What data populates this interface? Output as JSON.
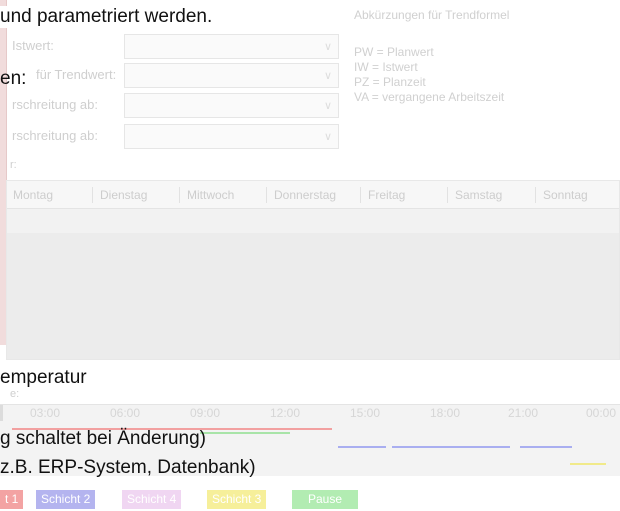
{
  "overlay": {
    "line1": "und parametriert werden.",
    "line2": "en:",
    "line3": "emperatur",
    "line4": "g  schaltet bei Änderung)",
    "line5": "z.B. ERP-System, Datenbank)"
  },
  "form": {
    "label_istwert": "Istwert:",
    "label_trendwert": "für Trendwert:",
    "label_ueber1": "rschreitung ab:",
    "label_ueber2": "rschreitung ab:",
    "label_small": "r:",
    "chevron": "∨"
  },
  "abbreviations": {
    "title": "Abkürzungen für Trendformel",
    "items": [
      "PW  =  Planwert",
      "IW  =  Istwert",
      "PZ  =  Planzeit",
      "VA   =  vergangene Arbeitszeit"
    ]
  },
  "week": {
    "days": [
      "Montag",
      "Dienstag",
      "Mittwoch",
      "Donnerstag",
      "Freitag",
      "Samstag",
      "Sonntag"
    ]
  },
  "timeline": {
    "caption": "e:",
    "ticks": [
      "03:00",
      "06:00",
      "09:00",
      "12:00",
      "15:00",
      "18:00",
      "21:00",
      "00:00"
    ]
  },
  "legend": {
    "items": [
      {
        "label": "t 1",
        "color": "#f3a3a3"
      },
      {
        "label": "Schicht 2",
        "color": "#b4b4ef"
      },
      {
        "label": "Schicht 4",
        "color": "#f0d6f2"
      },
      {
        "label": "Schicht 3",
        "color": "#f6ef9a"
      },
      {
        "label": "Pause",
        "color": "#b2ecb2"
      }
    ]
  },
  "colors": {
    "overlay_text": "#111111",
    "faded_text": "#cfcfcf",
    "shift_red": "#f2a0a0",
    "shift_blue": "#a9aef0",
    "shift_green": "#9fe0a0",
    "shift_yellow": "#f1ea8a"
  }
}
